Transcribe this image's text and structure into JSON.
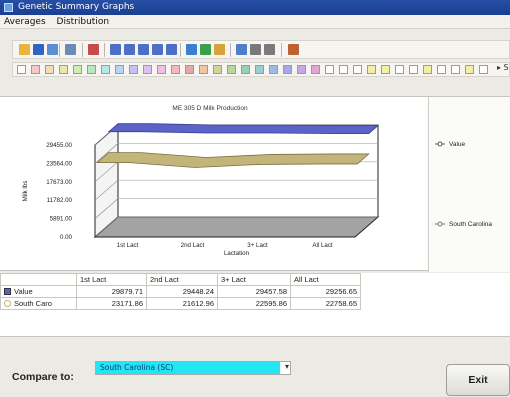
{
  "window": {
    "title": "Genetic Summary Graphs"
  },
  "menu": [
    "Averages",
    "Distribution"
  ],
  "colors": {
    "value_series": "#5b63c9",
    "comparison_series": "#c3b57a",
    "compare_highlight": "#24e6f0"
  },
  "toolbar_icons": [
    "folder-open-icon",
    "save-icon",
    "print-icon",
    "chart-type-icon",
    "color-icon",
    "view-icon",
    "view-icon",
    "view-icon",
    "view-icon",
    "view-icon",
    "arrows-icon",
    "add-icon",
    "edit-icon",
    "zoom-icon",
    "copy-icon",
    "text-icon",
    "tool-icon"
  ],
  "palette_colors": [
    "#ffffff",
    "#f4c9c9",
    "#f1dcb6",
    "#e7e7b3",
    "#d1ecb6",
    "#bde6c3",
    "#b8e7e2",
    "#b9d6f0",
    "#c2c2ef",
    "#dcc2ee",
    "#efc1e2",
    "#f2b9c0",
    "#e4a8a8",
    "#f0c7a0",
    "#d6d2a0",
    "#b8d8a0",
    "#98cfb0",
    "#98cfd0",
    "#9fb8e4",
    "#a8a8e4",
    "#c4a8e4",
    "#e0a8d0",
    "#ffffff",
    "#ffffff",
    "#ffffff",
    "#f4efa8",
    "#f4efa8",
    "#ffffff",
    "#ffffff",
    "#f4efa8",
    "#ffffff",
    "#ffffff",
    "#f4efa8",
    "#ffffff"
  ],
  "chart_data": {
    "type": "area",
    "title": "ME 305 D Milk Production",
    "xlabel": "Lactation",
    "ylabel": "Milk lbs",
    "categories": [
      "1st Lact",
      "2nd Lact",
      "3+ Lact",
      "All Lact"
    ],
    "y_ticks": [
      "0.00",
      "5891.00",
      "11782.00",
      "17673.00",
      "23564.00",
      "29455.00"
    ],
    "ylim": [
      0,
      29455
    ],
    "series": [
      {
        "name": "Value",
        "values": [
          29879.71,
          29448.24,
          29457.58,
          29256.65
        ]
      },
      {
        "name": "South Carolina",
        "values": [
          23171.86,
          21612.96,
          22595.86,
          22758.65
        ]
      }
    ]
  },
  "table": {
    "headers": [
      "",
      "1st Lact",
      "2nd Lact",
      "3+ Lact",
      "All Lact"
    ],
    "rows": [
      {
        "label": "Value",
        "cells": [
          "29879.71",
          "29448.24",
          "29457.58",
          "29256.65"
        ]
      },
      {
        "label": "South Caro",
        "cells": [
          "23171.86",
          "21612.96",
          "22595.86",
          "22758.65"
        ]
      }
    ]
  },
  "compare": {
    "label": "Compare to:",
    "selected": "South Carolina (SC)"
  },
  "exit_label": "Exit"
}
